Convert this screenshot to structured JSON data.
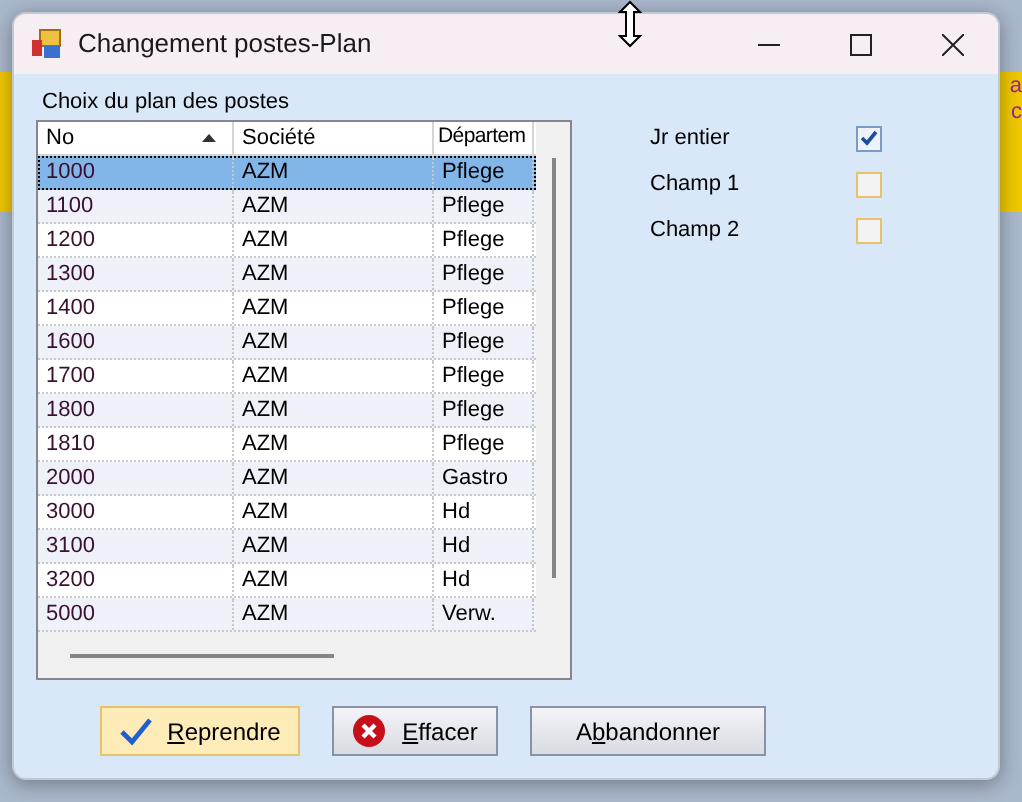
{
  "window": {
    "title": "Changement postes-Plan"
  },
  "group_label": "Choix du plan des postes",
  "table": {
    "columns": [
      {
        "label": "No",
        "sorted": true
      },
      {
        "label": "Société",
        "sorted": false
      },
      {
        "label": "Départem",
        "sorted": false
      }
    ],
    "rows": [
      {
        "cells": [
          "1000",
          "AZM",
          "Pflege"
        ],
        "selected": true
      },
      {
        "cells": [
          "1100",
          "AZM",
          "Pflege"
        ],
        "selected": false
      },
      {
        "cells": [
          "1200",
          "AZM",
          "Pflege"
        ],
        "selected": false
      },
      {
        "cells": [
          "1300",
          "AZM",
          "Pflege"
        ],
        "selected": false
      },
      {
        "cells": [
          "1400",
          "AZM",
          "Pflege"
        ],
        "selected": false
      },
      {
        "cells": [
          "1600",
          "AZM",
          "Pflege"
        ],
        "selected": false
      },
      {
        "cells": [
          "1700",
          "AZM",
          "Pflege"
        ],
        "selected": false
      },
      {
        "cells": [
          "1800",
          "AZM",
          "Pflege"
        ],
        "selected": false
      },
      {
        "cells": [
          "1810",
          "AZM",
          "Pflege"
        ],
        "selected": false
      },
      {
        "cells": [
          "2000",
          "AZM",
          "Gastro"
        ],
        "selected": false
      },
      {
        "cells": [
          "3000",
          "AZM",
          "Hd"
        ],
        "selected": false
      },
      {
        "cells": [
          "3100",
          "AZM",
          "Hd"
        ],
        "selected": false
      },
      {
        "cells": [
          "3200",
          "AZM",
          "Hd"
        ],
        "selected": false
      },
      {
        "cells": [
          "5000",
          "AZM",
          "Verw."
        ],
        "selected": false
      }
    ]
  },
  "options": [
    {
      "label": "Jr entier",
      "checked": true
    },
    {
      "label": "Champ 1",
      "checked": false
    },
    {
      "label": "Champ 2",
      "checked": false
    }
  ],
  "buttons": [
    {
      "kind": "confirm",
      "key": "R",
      "after": "eprendre",
      "highlighted": true
    },
    {
      "kind": "clear",
      "key": "E",
      "after": "ffacer",
      "highlighted": false
    },
    {
      "kind": "cancel",
      "before": "A",
      "key": "b",
      "after": "bandonner",
      "highlighted": false
    }
  ],
  "background_texts": [
    "a",
    "c"
  ]
}
